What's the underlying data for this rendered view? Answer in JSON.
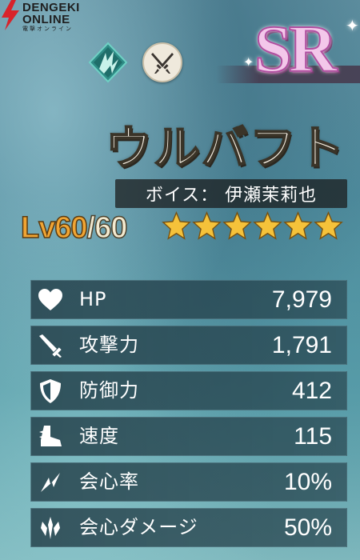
{
  "watermark": {
    "line1": "DENGEKI",
    "line2": "ONLINE",
    "line3": "電撃オンライン"
  },
  "character": {
    "rarity": "SR",
    "name": "ウルバフト",
    "voice": "ボイス：  伊瀬茉莉也",
    "level_prefix": "Lv",
    "level_current": "60",
    "level_separator": "/",
    "level_max": "60",
    "star_count": 6,
    "star_color": "#f5c23a"
  },
  "icons": {
    "element": "wind-element-icon",
    "weapon": "dual-daggers-icon"
  },
  "stats": [
    {
      "icon": "heart-icon",
      "label": "HP",
      "value": "7,979"
    },
    {
      "icon": "sword-icon",
      "label": "攻撃力",
      "value": "1,791"
    },
    {
      "icon": "shield-icon",
      "label": "防御力",
      "value": "412"
    },
    {
      "icon": "boot-icon",
      "label": "速度",
      "value": "115"
    },
    {
      "icon": "critical-icon",
      "label": "会心率",
      "value": "10%"
    },
    {
      "icon": "critical-damage-icon",
      "label": "会心ダメージ",
      "value": "50%"
    }
  ]
}
